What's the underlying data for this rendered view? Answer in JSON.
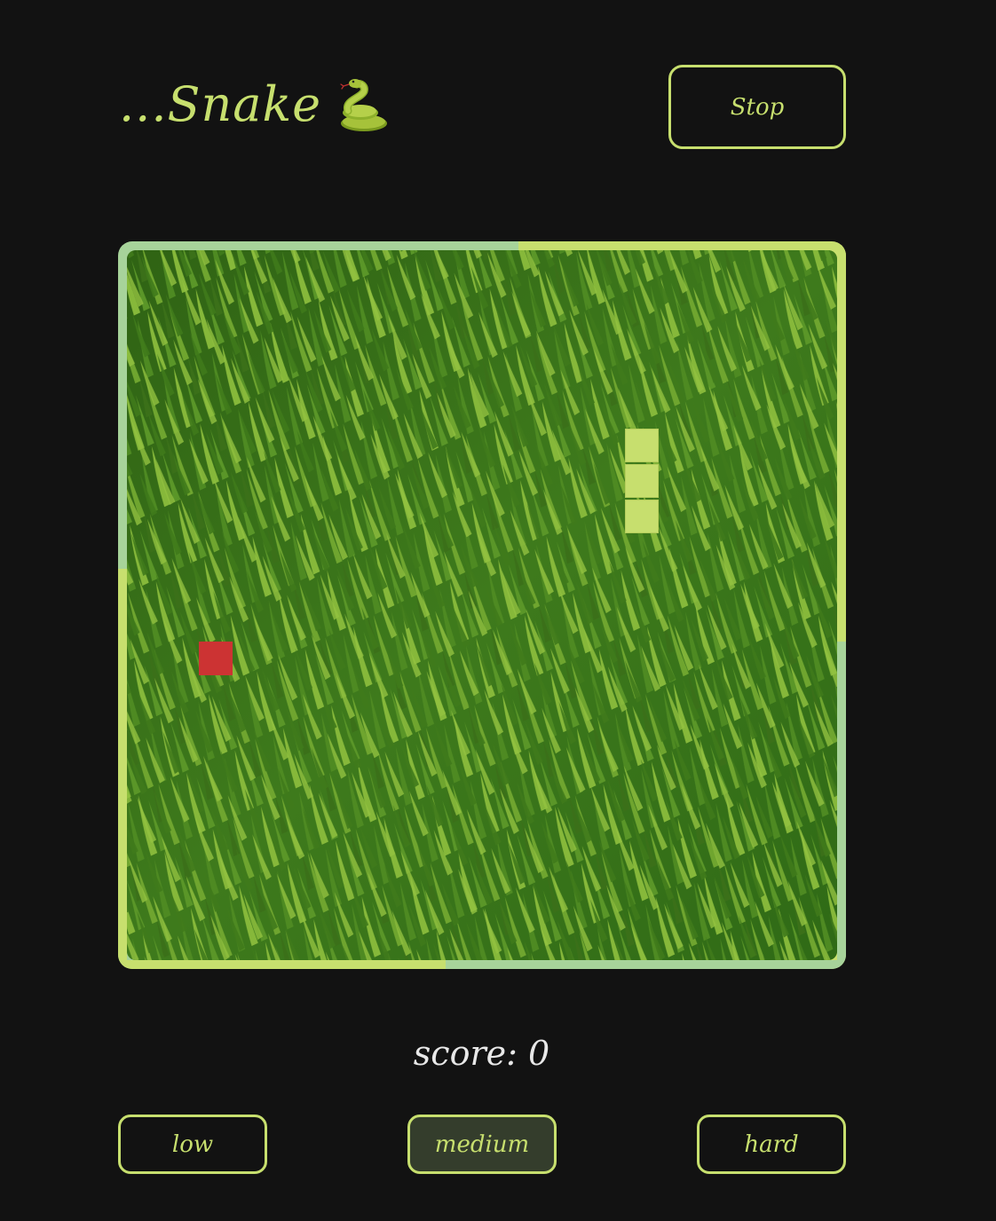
{
  "header": {
    "title": "...Snake",
    "title_icon": "snake-icon",
    "stop_label": "Stop"
  },
  "board": {
    "grid_size": 20,
    "snake_color": "#c7df6e",
    "food_color": "#cc3333",
    "snake": [
      {
        "col": 14,
        "row": 5
      },
      {
        "col": 14,
        "row": 6
      },
      {
        "col": 14,
        "row": 7
      }
    ],
    "food": {
      "col": 2,
      "row": 11
    }
  },
  "score": {
    "label": "score:",
    "value": "0"
  },
  "difficulty": {
    "selected": "medium",
    "options": [
      "low",
      "medium",
      "hard"
    ]
  },
  "colors": {
    "accent": "#c7df6e",
    "background": "#121212",
    "active_button_bg": "#343d2c"
  }
}
